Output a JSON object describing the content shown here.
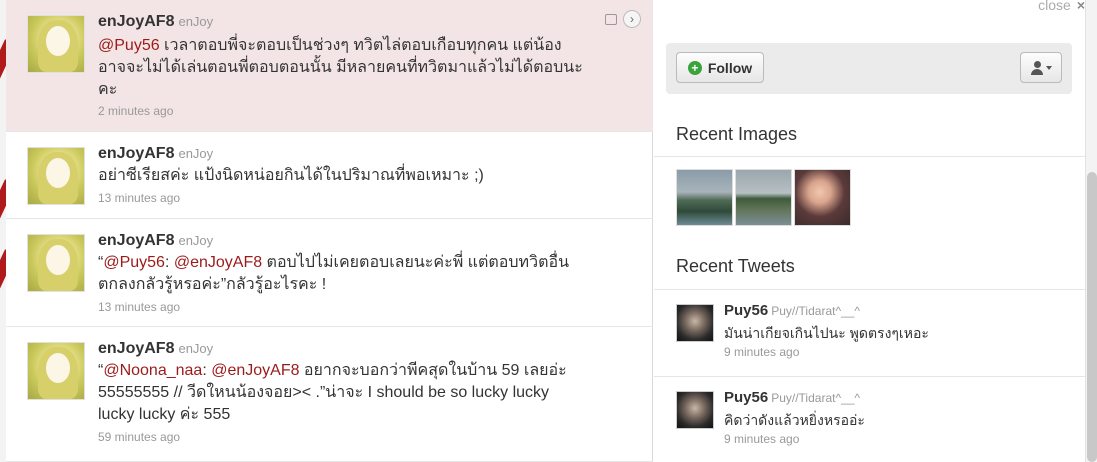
{
  "timeline": {
    "tweets": [
      {
        "name": "enJoyAF8",
        "handle": "enJoy",
        "mention1": "@Puy56",
        "text_line1": " เวลาตอบพี่จะตอบเป็นช่วงๆ ทวิตไล่ตอบเกือบทุกคน แต่น้อง",
        "text_line2": "อาจจะไม่ได้เล่นตอนพี่ตอบตอนนั้น มีหลายคนที่ทวิตมาแล้วไม่ได้ตอบนะ",
        "text_line3": "คะ",
        "time": "2 minutes ago"
      },
      {
        "name": "enJoyAF8",
        "handle": "enJoy",
        "text_line1": "อย่าซีเรียสค่ะ แป้งนิดหน่อยกินได้ในปริมาณที่พอเหมาะ ;)",
        "time": "13 minutes ago"
      },
      {
        "name": "enJoyAF8",
        "handle": "enJoy",
        "quote_open": "“",
        "mention1": "@Puy56",
        "colon": ": ",
        "mention2": "@enJoyAF8",
        "text_line1": " ตอบไปไม่เคยตอบเลยนะค่ะพี่ แต่ตอบทวิตอื่น",
        "text_line2": "ตกลงกลัวรู้หรอค่ะ”กลัวรู้อะไรคะ !",
        "time": "13 minutes ago"
      },
      {
        "name": "enJoyAF8",
        "handle": "enJoy",
        "quote_open": "“",
        "mention1": "@Noona_naa",
        "colon": ": ",
        "mention2": "@enJoyAF8",
        "text_line1": " อยากจะบอกว่าพีคสุดในบ้าน 59 เลยอ่ะ",
        "text_line2": "55555555 // วีดใหนน้องจอย>< .”น่าจะ I should be so lucky lucky",
        "text_line3": "lucky lucky ค่ะ 555",
        "time": "59 minutes ago"
      }
    ]
  },
  "panel": {
    "close_label": "close",
    "close_icon": "×",
    "follow_label": "Follow",
    "plus_glyph": "+",
    "recent_images_title": "Recent Images",
    "recent_tweets_title": "Recent Tweets",
    "recent_tweets": [
      {
        "name": "Puy56",
        "handle": "Puy//Tidarat^__^",
        "text": "มันน่าเกียจเกินไปนะ พูดตรงๆเหอะ",
        "time": "9 minutes ago"
      },
      {
        "name": "Puy56",
        "handle": "Puy//Tidarat^__^",
        "text": "คิดว่าดังแล้วหยิ่งหรออ่ะ",
        "time": "9 minutes ago"
      }
    ]
  },
  "colors": {
    "accent_mention": "#9c1a1a",
    "highlight_bg": "#f3e5e5",
    "follow_plus": "#3ba33b"
  }
}
